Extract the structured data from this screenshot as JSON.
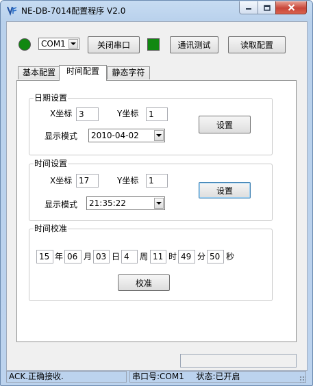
{
  "window": {
    "title": "NE-DB-7014配置程序 V2.0"
  },
  "toolbar": {
    "port_value": "COM1",
    "close_port_label": "关闭串口",
    "comm_test_label": "通讯测试",
    "read_config_label": "读取配置"
  },
  "tabs": [
    {
      "label": "基本配置",
      "active": false
    },
    {
      "label": "时间配置",
      "active": true
    },
    {
      "label": "静态字符",
      "active": false
    }
  ],
  "date_group": {
    "title": "日期设置",
    "x_label": "X坐标",
    "x_value": "3",
    "y_label": "Y坐标",
    "y_value": "1",
    "mode_label": "显示模式",
    "mode_value": "2010-04-02",
    "set_label": "设置"
  },
  "time_group": {
    "title": "时间设置",
    "x_label": "X坐标",
    "x_value": "17",
    "y_label": "Y坐标",
    "y_value": "1",
    "mode_label": "显示模式",
    "mode_value": "21:35:22",
    "set_label": "设置"
  },
  "calibrate_group": {
    "title": "时间校准",
    "year_value": "15",
    "year_label": "年",
    "month_value": "06",
    "month_label": "月",
    "day_value": "03",
    "day_label": "日",
    "week_value": "4",
    "week_label": "周",
    "hour_value": "11",
    "hour_label": "时",
    "minute_value": "49",
    "minute_label": "分",
    "second_value": "50",
    "second_label": "秒",
    "calibrate_label": "校准"
  },
  "status_bar": {
    "message": "ACK.正确接收.",
    "port": "串口号:COM1",
    "state": "状态:已开启"
  },
  "colors": {
    "led_on": "#118811",
    "title_bar": "#c7dcf2",
    "close_button": "#c8463a"
  }
}
